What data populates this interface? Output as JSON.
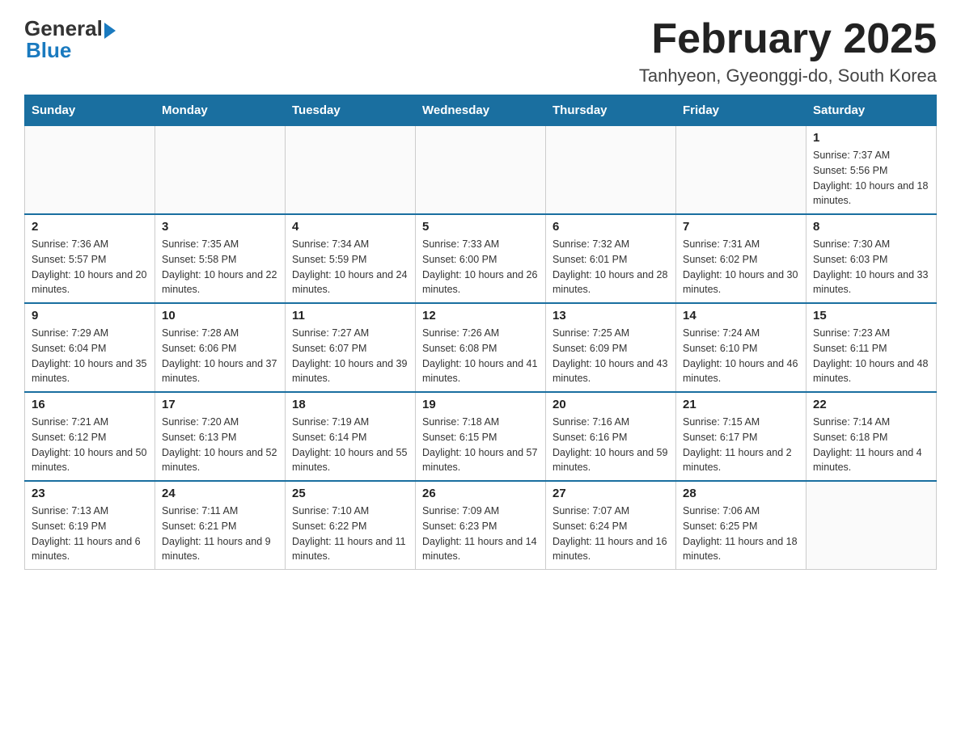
{
  "header": {
    "logo_general": "General",
    "logo_blue": "Blue",
    "month_title": "February 2025",
    "location": "Tanhyeon, Gyeonggi-do, South Korea"
  },
  "days_of_week": [
    "Sunday",
    "Monday",
    "Tuesday",
    "Wednesday",
    "Thursday",
    "Friday",
    "Saturday"
  ],
  "weeks": [
    [
      {
        "day": "",
        "sunrise": "",
        "sunset": "",
        "daylight": ""
      },
      {
        "day": "",
        "sunrise": "",
        "sunset": "",
        "daylight": ""
      },
      {
        "day": "",
        "sunrise": "",
        "sunset": "",
        "daylight": ""
      },
      {
        "day": "",
        "sunrise": "",
        "sunset": "",
        "daylight": ""
      },
      {
        "day": "",
        "sunrise": "",
        "sunset": "",
        "daylight": ""
      },
      {
        "day": "",
        "sunrise": "",
        "sunset": "",
        "daylight": ""
      },
      {
        "day": "1",
        "sunrise": "Sunrise: 7:37 AM",
        "sunset": "Sunset: 5:56 PM",
        "daylight": "Daylight: 10 hours and 18 minutes."
      }
    ],
    [
      {
        "day": "2",
        "sunrise": "Sunrise: 7:36 AM",
        "sunset": "Sunset: 5:57 PM",
        "daylight": "Daylight: 10 hours and 20 minutes."
      },
      {
        "day": "3",
        "sunrise": "Sunrise: 7:35 AM",
        "sunset": "Sunset: 5:58 PM",
        "daylight": "Daylight: 10 hours and 22 minutes."
      },
      {
        "day": "4",
        "sunrise": "Sunrise: 7:34 AM",
        "sunset": "Sunset: 5:59 PM",
        "daylight": "Daylight: 10 hours and 24 minutes."
      },
      {
        "day": "5",
        "sunrise": "Sunrise: 7:33 AM",
        "sunset": "Sunset: 6:00 PM",
        "daylight": "Daylight: 10 hours and 26 minutes."
      },
      {
        "day": "6",
        "sunrise": "Sunrise: 7:32 AM",
        "sunset": "Sunset: 6:01 PM",
        "daylight": "Daylight: 10 hours and 28 minutes."
      },
      {
        "day": "7",
        "sunrise": "Sunrise: 7:31 AM",
        "sunset": "Sunset: 6:02 PM",
        "daylight": "Daylight: 10 hours and 30 minutes."
      },
      {
        "day": "8",
        "sunrise": "Sunrise: 7:30 AM",
        "sunset": "Sunset: 6:03 PM",
        "daylight": "Daylight: 10 hours and 33 minutes."
      }
    ],
    [
      {
        "day": "9",
        "sunrise": "Sunrise: 7:29 AM",
        "sunset": "Sunset: 6:04 PM",
        "daylight": "Daylight: 10 hours and 35 minutes."
      },
      {
        "day": "10",
        "sunrise": "Sunrise: 7:28 AM",
        "sunset": "Sunset: 6:06 PM",
        "daylight": "Daylight: 10 hours and 37 minutes."
      },
      {
        "day": "11",
        "sunrise": "Sunrise: 7:27 AM",
        "sunset": "Sunset: 6:07 PM",
        "daylight": "Daylight: 10 hours and 39 minutes."
      },
      {
        "day": "12",
        "sunrise": "Sunrise: 7:26 AM",
        "sunset": "Sunset: 6:08 PM",
        "daylight": "Daylight: 10 hours and 41 minutes."
      },
      {
        "day": "13",
        "sunrise": "Sunrise: 7:25 AM",
        "sunset": "Sunset: 6:09 PM",
        "daylight": "Daylight: 10 hours and 43 minutes."
      },
      {
        "day": "14",
        "sunrise": "Sunrise: 7:24 AM",
        "sunset": "Sunset: 6:10 PM",
        "daylight": "Daylight: 10 hours and 46 minutes."
      },
      {
        "day": "15",
        "sunrise": "Sunrise: 7:23 AM",
        "sunset": "Sunset: 6:11 PM",
        "daylight": "Daylight: 10 hours and 48 minutes."
      }
    ],
    [
      {
        "day": "16",
        "sunrise": "Sunrise: 7:21 AM",
        "sunset": "Sunset: 6:12 PM",
        "daylight": "Daylight: 10 hours and 50 minutes."
      },
      {
        "day": "17",
        "sunrise": "Sunrise: 7:20 AM",
        "sunset": "Sunset: 6:13 PM",
        "daylight": "Daylight: 10 hours and 52 minutes."
      },
      {
        "day": "18",
        "sunrise": "Sunrise: 7:19 AM",
        "sunset": "Sunset: 6:14 PM",
        "daylight": "Daylight: 10 hours and 55 minutes."
      },
      {
        "day": "19",
        "sunrise": "Sunrise: 7:18 AM",
        "sunset": "Sunset: 6:15 PM",
        "daylight": "Daylight: 10 hours and 57 minutes."
      },
      {
        "day": "20",
        "sunrise": "Sunrise: 7:16 AM",
        "sunset": "Sunset: 6:16 PM",
        "daylight": "Daylight: 10 hours and 59 minutes."
      },
      {
        "day": "21",
        "sunrise": "Sunrise: 7:15 AM",
        "sunset": "Sunset: 6:17 PM",
        "daylight": "Daylight: 11 hours and 2 minutes."
      },
      {
        "day": "22",
        "sunrise": "Sunrise: 7:14 AM",
        "sunset": "Sunset: 6:18 PM",
        "daylight": "Daylight: 11 hours and 4 minutes."
      }
    ],
    [
      {
        "day": "23",
        "sunrise": "Sunrise: 7:13 AM",
        "sunset": "Sunset: 6:19 PM",
        "daylight": "Daylight: 11 hours and 6 minutes."
      },
      {
        "day": "24",
        "sunrise": "Sunrise: 7:11 AM",
        "sunset": "Sunset: 6:21 PM",
        "daylight": "Daylight: 11 hours and 9 minutes."
      },
      {
        "day": "25",
        "sunrise": "Sunrise: 7:10 AM",
        "sunset": "Sunset: 6:22 PM",
        "daylight": "Daylight: 11 hours and 11 minutes."
      },
      {
        "day": "26",
        "sunrise": "Sunrise: 7:09 AM",
        "sunset": "Sunset: 6:23 PM",
        "daylight": "Daylight: 11 hours and 14 minutes."
      },
      {
        "day": "27",
        "sunrise": "Sunrise: 7:07 AM",
        "sunset": "Sunset: 6:24 PM",
        "daylight": "Daylight: 11 hours and 16 minutes."
      },
      {
        "day": "28",
        "sunrise": "Sunrise: 7:06 AM",
        "sunset": "Sunset: 6:25 PM",
        "daylight": "Daylight: 11 hours and 18 minutes."
      },
      {
        "day": "",
        "sunrise": "",
        "sunset": "",
        "daylight": ""
      }
    ]
  ]
}
